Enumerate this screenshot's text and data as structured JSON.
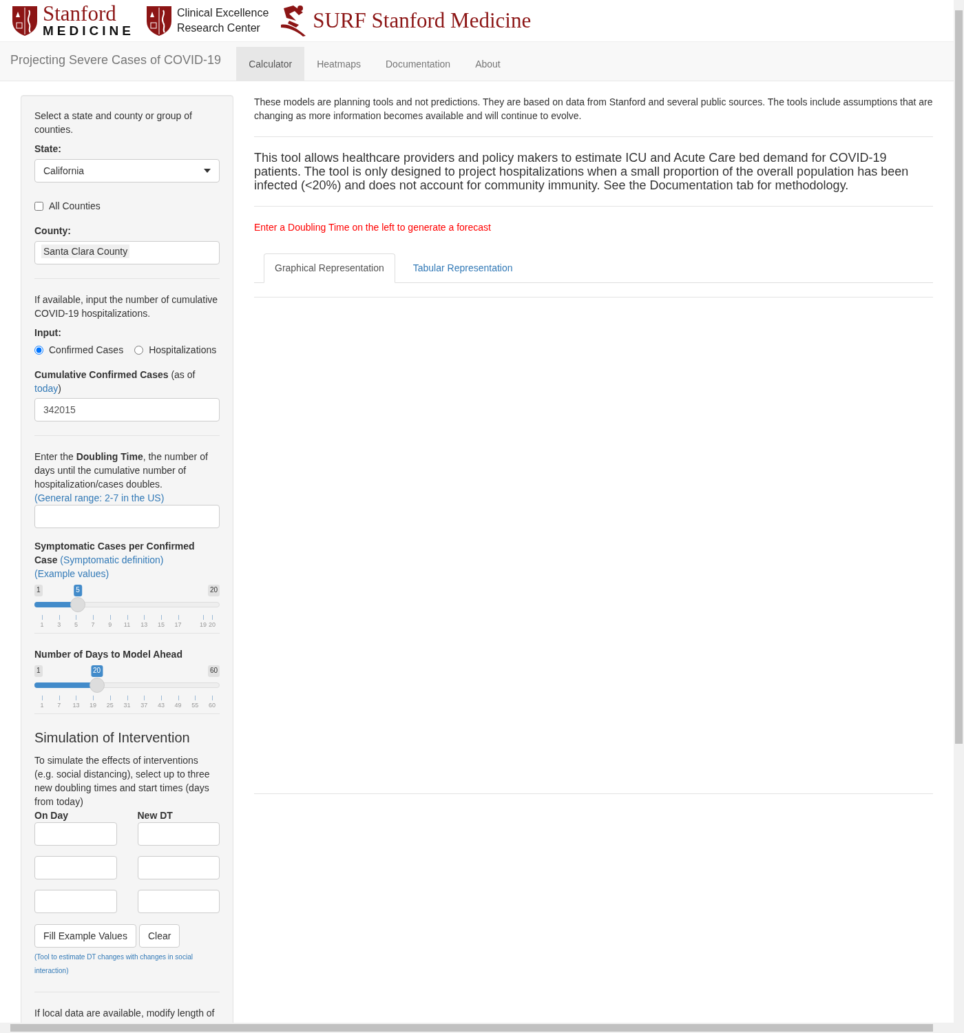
{
  "logos": [
    {
      "kind": "stacked",
      "line_1": "Stanford",
      "line_2": "MEDICINE"
    },
    {
      "kind": "stacked",
      "line_1": "Clinical Excellence",
      "line_2": "Research Center"
    },
    {
      "kind": "surf",
      "line_1": "SURF Stanford Medicine"
    }
  ],
  "navbar": {
    "brand": "Projecting Severe Cases of COVID-19",
    "items": [
      {
        "label": "Calculator",
        "selected": true
      },
      {
        "label": "Heatmaps",
        "selected": false
      },
      {
        "label": "Documentation",
        "selected": false
      },
      {
        "label": "About",
        "selected": false
      }
    ]
  },
  "sidebar": {
    "intro": "Select a state and county or group of counties.",
    "state": {
      "label": "State:",
      "value": "California"
    },
    "all_counties": {
      "label": "All Counties",
      "checked": false
    },
    "county": {
      "label": "County:",
      "value": "Santa Clara County"
    },
    "hosp_intro": "If available, input the number of cumulative COVID-19 hospitalizations.",
    "input": {
      "label": "Input:",
      "options": [
        {
          "label": "Confirmed Cases",
          "selected": true
        },
        {
          "label": "Hospitalizations",
          "selected": false
        }
      ]
    },
    "cases": {
      "label": "**Cumulative Confirmed Cases** (as of",
      "link": "today",
      "after": ")",
      "value": "342015"
    },
    "doubling": {
      "text": "Enter the **Doubling Time**, the number of days until the cumulative number of hospitalization/cases doubles.",
      "link": "(General range: 2-7 in the US)"
    },
    "sliders": [
      {
        "label": "Symptomatic Cases per Confirmed Case",
        "links": [
          "(Symptomatic definition)",
          "(Example values)"
        ],
        "min": "1",
        "max": "20",
        "value": "5",
        "level": 0.2105,
        "ticks": [
          "1",
          "3",
          "5",
          "7",
          "9",
          "11",
          "13",
          "15",
          "17",
          "19",
          "20"
        ]
      },
      {
        "label": "Number of Days to Model Ahead",
        "min": "1",
        "max": "60",
        "value": "20",
        "level": 0.322,
        "ticks": [
          "1",
          "7",
          "13",
          "19",
          "25",
          "31",
          "37",
          "43",
          "49",
          "55",
          "60"
        ]
      }
    ],
    "intervention": {
      "title": "Simulation of Intervention",
      "text": "To simulate the effects of interventions (e.g. social distancing), select up to three new doubling times and start times (days from today)",
      "col_1": "On Day",
      "col_2": "New DT",
      "buttons": [
        "Fill Example Values",
        "Clear"
      ],
      "link": "(Tool to estimate DT changes with changes in social interaction)"
    },
    "local": "If local data are available, modify length of"
  },
  "main": {
    "disclaimer": "These models are planning tools and not predictions. They are based on data from Stanford and several public sources. The tools include assumptions that are changing as more information becomes available and will continue to evolve.",
    "lead": "This tool allows healthcare providers and policy makers to estimate ICU and Acute Care bed demand for COVID-19 patients. The tool is only designed to project hospitalizations when a small proportion of the overall population has been infected (<20%) and does not account for community immunity. See the Documentation tab for methodology.",
    "warning": "Enter a Doubling Time on the left to generate a forecast",
    "tabs": [
      {
        "label": "Graphical Representation",
        "selected": true
      },
      {
        "label": "Tabular Representation",
        "selected": false
      }
    ]
  }
}
